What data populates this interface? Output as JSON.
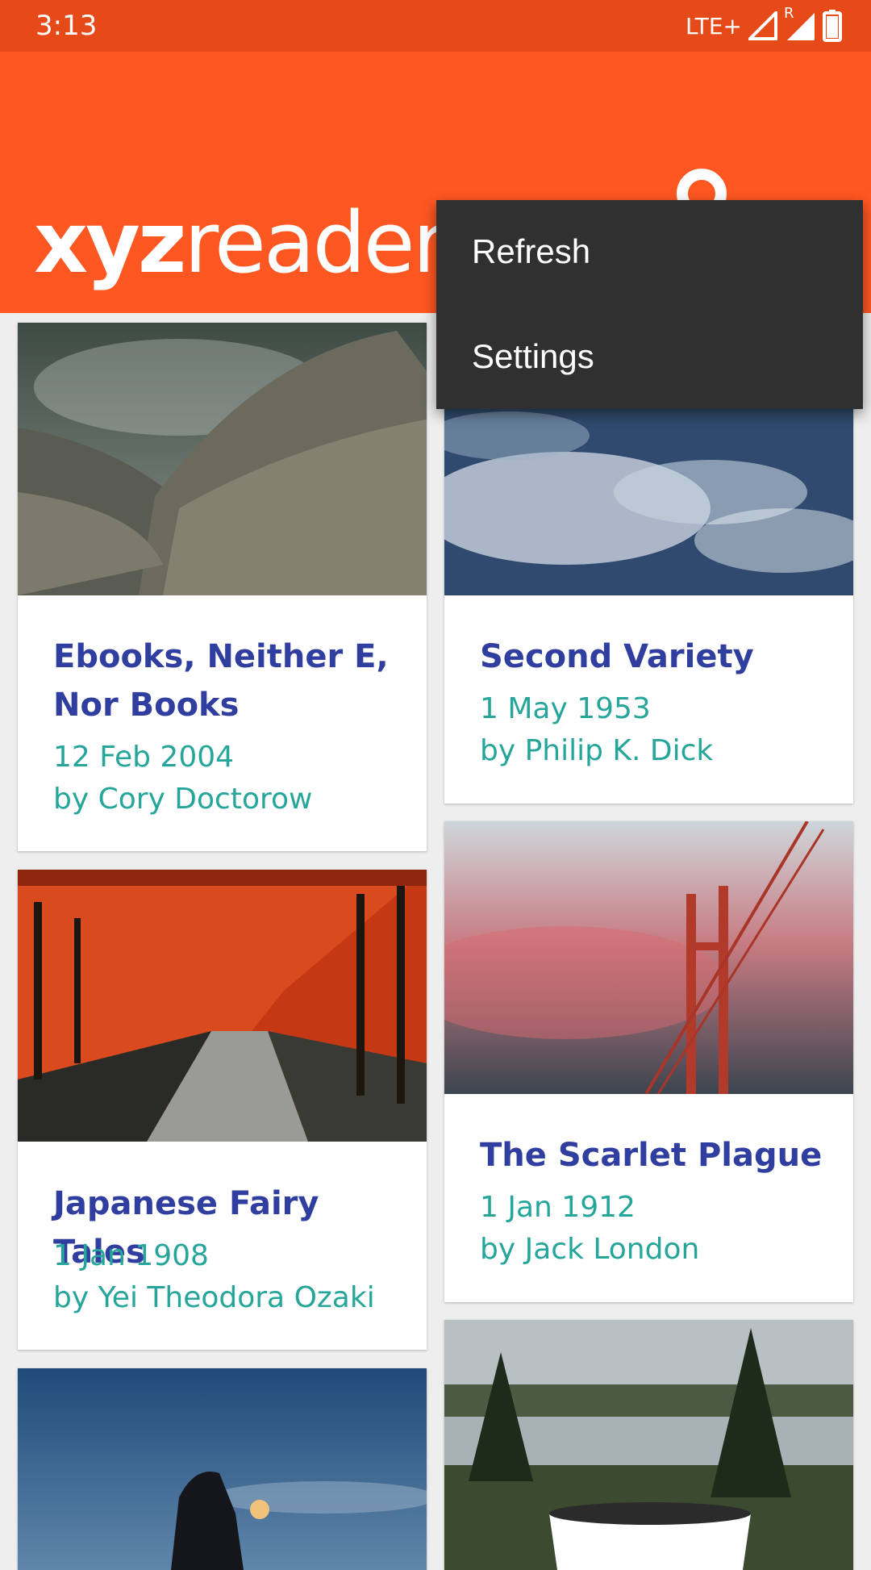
{
  "status_bar": {
    "time": "3:13",
    "network": "LTE+",
    "roaming": "R"
  },
  "app_bar": {
    "logo_bold": "xyz",
    "logo_light": "reader",
    "account_icon": "account-icon",
    "color": "#ff5722"
  },
  "menu": {
    "items": [
      {
        "label": "Refresh"
      },
      {
        "label": "Settings"
      }
    ]
  },
  "articles": [
    {
      "title": "Ebooks, Neither E, Nor Books",
      "date": "12 Feb 2004",
      "author": "by Cory Doctorow"
    },
    {
      "title": "Second Variety",
      "date": "1 May 1953",
      "author": "by Philip K. Dick"
    },
    {
      "title": "Japanese Fairy Tales",
      "date": "1 Jan 1908",
      "author": "by Yei Theodora Ozaki"
    },
    {
      "title": "The Scarlet Plague",
      "date": "1 Jan 1912",
      "author": "by Jack London"
    }
  ],
  "colors": {
    "title": "#303f9f",
    "meta": "#26a69a",
    "status_bar": "#e64a19",
    "menu_bg": "#303030"
  }
}
